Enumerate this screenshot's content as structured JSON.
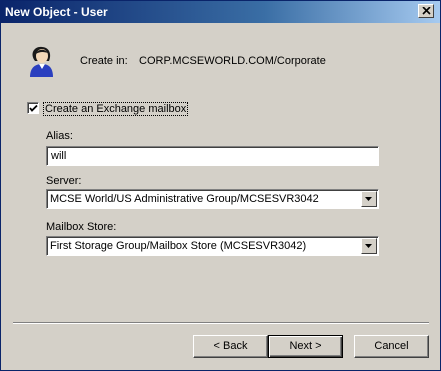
{
  "window": {
    "title": "New Object - User"
  },
  "header": {
    "create_in_label": "Create in:",
    "create_in_value": "CORP.MCSEWORLD.COM/Corporate"
  },
  "mailbox": {
    "checkbox_label": "Create an Exchange mailbox",
    "checked": true,
    "alias_label": "Alias:",
    "alias_value": "will",
    "server_label": "Server:",
    "server_value": "MCSE World/US Administrative Group/MCSESVR3042",
    "store_label": "Mailbox Store:",
    "store_value": "First Storage Group/Mailbox Store (MCSESVR3042)"
  },
  "buttons": {
    "back": "< Back",
    "next": "Next >",
    "cancel": "Cancel"
  },
  "colors": {
    "titlebar_start": "#0a246a",
    "titlebar_end": "#a6caf0",
    "face": "#d4d0c8"
  },
  "icons": {
    "close": "close-icon",
    "user": "user-icon",
    "check": "checkmark-icon",
    "dropdown": "chevron-down-icon"
  }
}
